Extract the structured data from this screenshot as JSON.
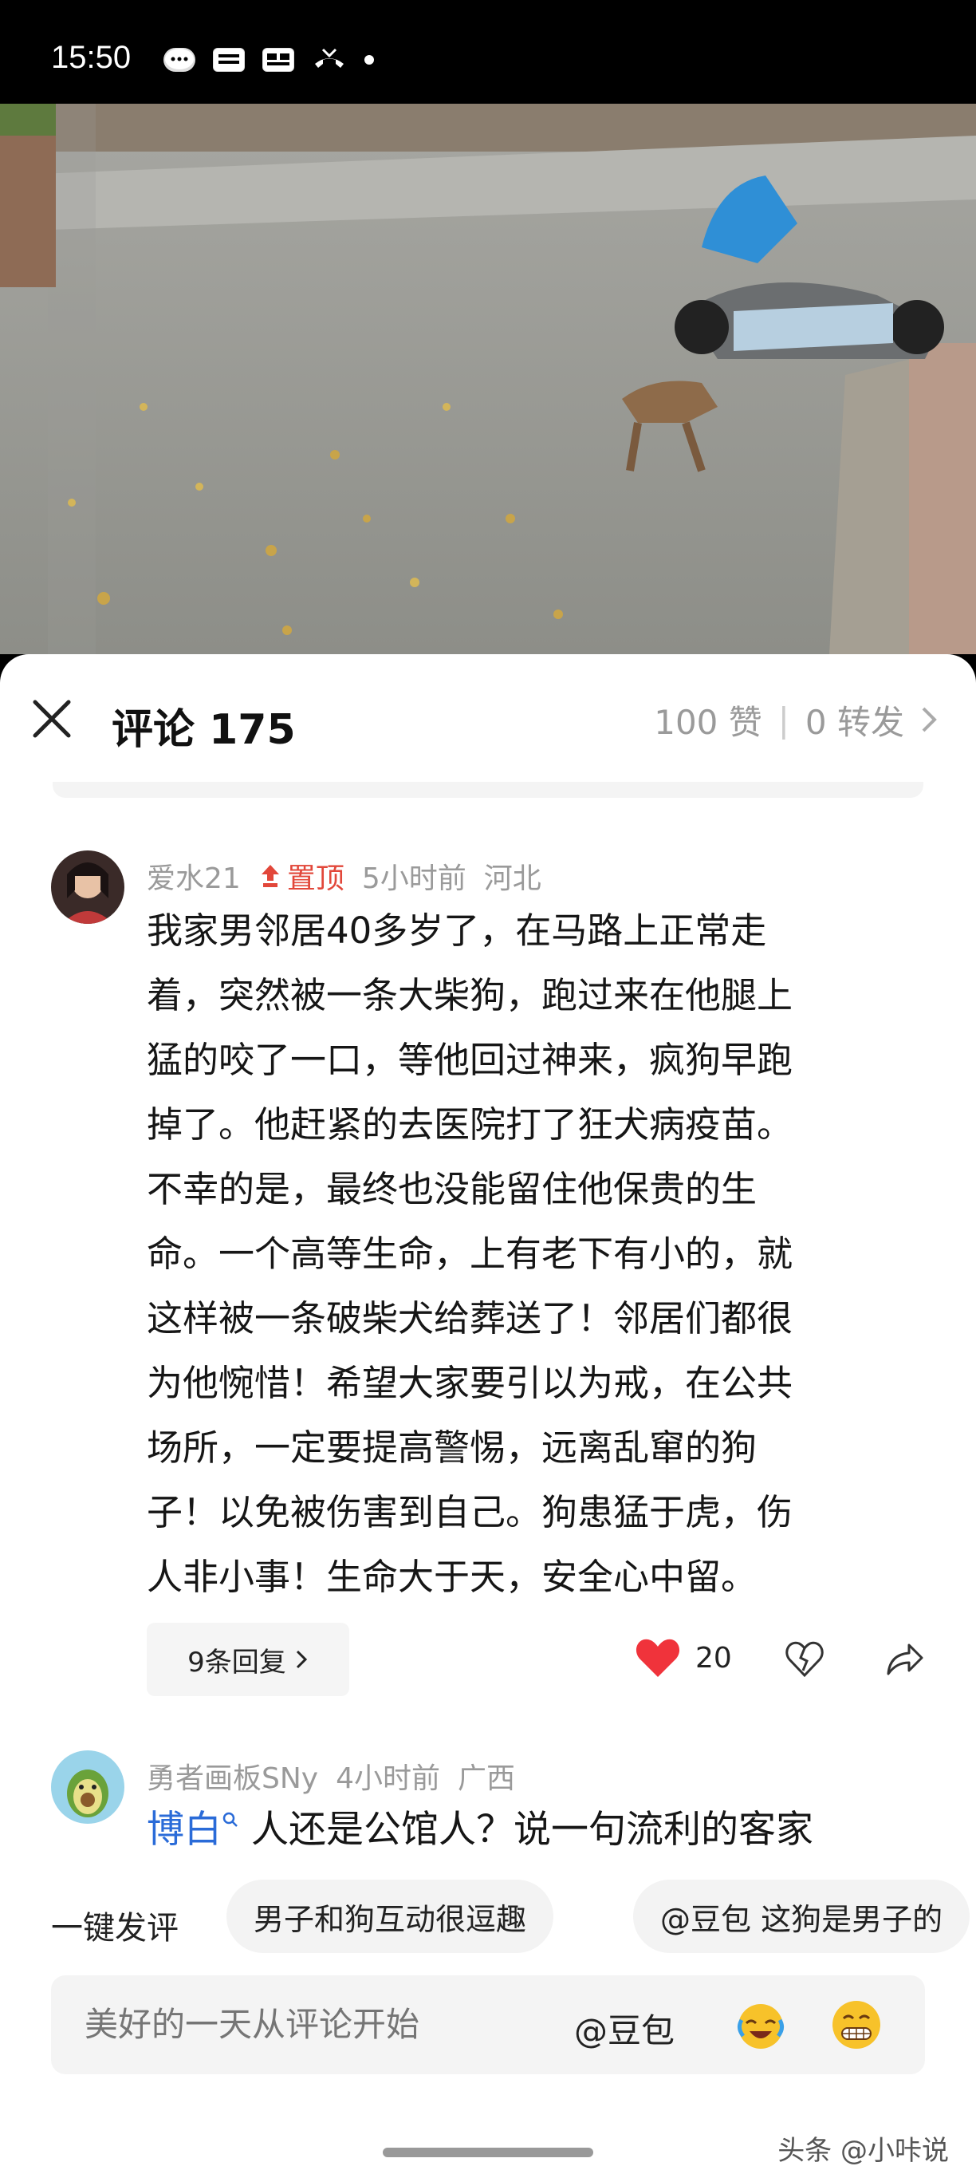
{
  "status_bar": {
    "time": "15:50",
    "icons": [
      "message-bubble-icon",
      "news-app-icon",
      "toutiao-app-icon",
      "missed-call-icon",
      "dot-icon"
    ]
  },
  "panel": {
    "title": "评论 175",
    "likes": "100 赞",
    "separator": "|",
    "reposts": "0 转发"
  },
  "comments": [
    {
      "user": "爱水21",
      "pinned_label": "置顶",
      "time": "5小时前",
      "location": "河北",
      "lines": [
        "我家男邻居40多岁了，在马路上正常走",
        "着，突然被一条大柴狗，跑过来在他腿上",
        "猛的咬了一口，等他回过神来，疯狗早跑",
        "掉了。他赶紧的去医院打了狂犬病疫苗。",
        "不幸的是，最终也没能留住他保贵的生",
        "命。一个高等生命，上有老下有小的，就",
        "这样被一条破柴犬给葬送了！邻居们都很",
        "为他惋惜！希望大家要引以为戒，在公共",
        "场所，一定要提高警惕，远离乱窜的狗",
        "子！以免被伤害到自己。狗患猛于虎，伤",
        "人非小事！生命大于天，安全心中留。"
      ],
      "replies_label": "9条回复",
      "like_count": "20"
    },
    {
      "user": "勇者画板SNy",
      "time": "4小时前",
      "location": "广西",
      "mention": "博白",
      "text": " 人还是公馆人？说一句流利的客家"
    }
  ],
  "quick_comment": {
    "label": "一键发评",
    "chips": [
      "男子和狗互动很逗趣",
      "@豆包 这狗是男子的"
    ]
  },
  "input": {
    "placeholder": "美好的一天从评论开始",
    "at_doubao": "@豆包"
  },
  "watermark": "头条 @小咔说",
  "colors": {
    "accent_red": "#e2473a",
    "mention_blue": "#2a6bd8",
    "like_red": "#f0333b"
  }
}
